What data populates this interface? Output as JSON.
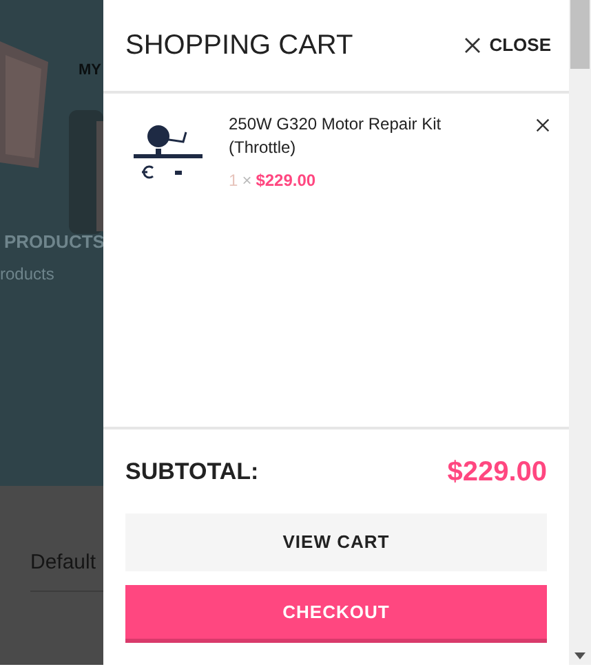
{
  "background": {
    "nav_label": "MY",
    "heading": "PRODUCTS",
    "subtext": "roducts",
    "sort_label": "Default"
  },
  "cart": {
    "title": "SHOPPING CART",
    "close_label": "CLOSE",
    "items": [
      {
        "name": "250W G320 Motor Repair Kit (Throttle)",
        "quantity": "1",
        "times": "×",
        "price": "$229.00"
      }
    ],
    "subtotal_label": "SUBTOTAL:",
    "subtotal": "$229.00",
    "buttons": [
      {
        "kind": "secondary",
        "label": "VIEW CART"
      },
      {
        "kind": "primary",
        "label": "CHECKOUT"
      }
    ]
  }
}
